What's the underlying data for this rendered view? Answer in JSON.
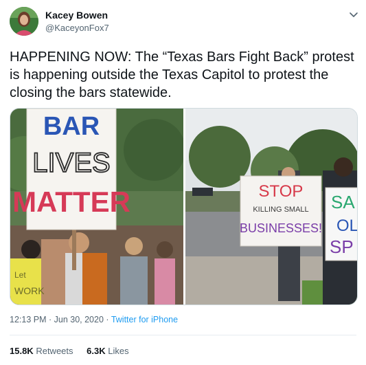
{
  "author": {
    "name": "Kacey Bowen",
    "handle": "@KaceyonFox7"
  },
  "tweet": {
    "text": "HAPPENING NOW: The “Texas Bars Fight Back” protest is happening outside the Texas Capitol to protest the closing the bars statewide."
  },
  "media": {
    "left_sign": {
      "line1": "BAR",
      "line2": "LIVES",
      "line3": "MATTER"
    },
    "left_sign_small": {
      "line1": "Let",
      "line2": "WORK"
    },
    "right_sign": {
      "line1": "STOP",
      "line2": "KILLING SMALL",
      "line3": "BUSINESSES!"
    },
    "right_sign_partial": {
      "line1": "SA",
      "line2": "OL",
      "line3": "SP"
    }
  },
  "meta": {
    "time": "12:13 PM",
    "separator": " · ",
    "date": "Jun 30, 2020",
    "source": "Twitter for iPhone"
  },
  "stats": {
    "retweets_count": "15.8K",
    "retweets_label": "Retweets",
    "likes_count": "6.3K",
    "likes_label": "Likes"
  },
  "colors": {
    "link": "#1d9bf0",
    "muted": "#536471"
  },
  "icons": {
    "more": "chevron-down-icon"
  }
}
